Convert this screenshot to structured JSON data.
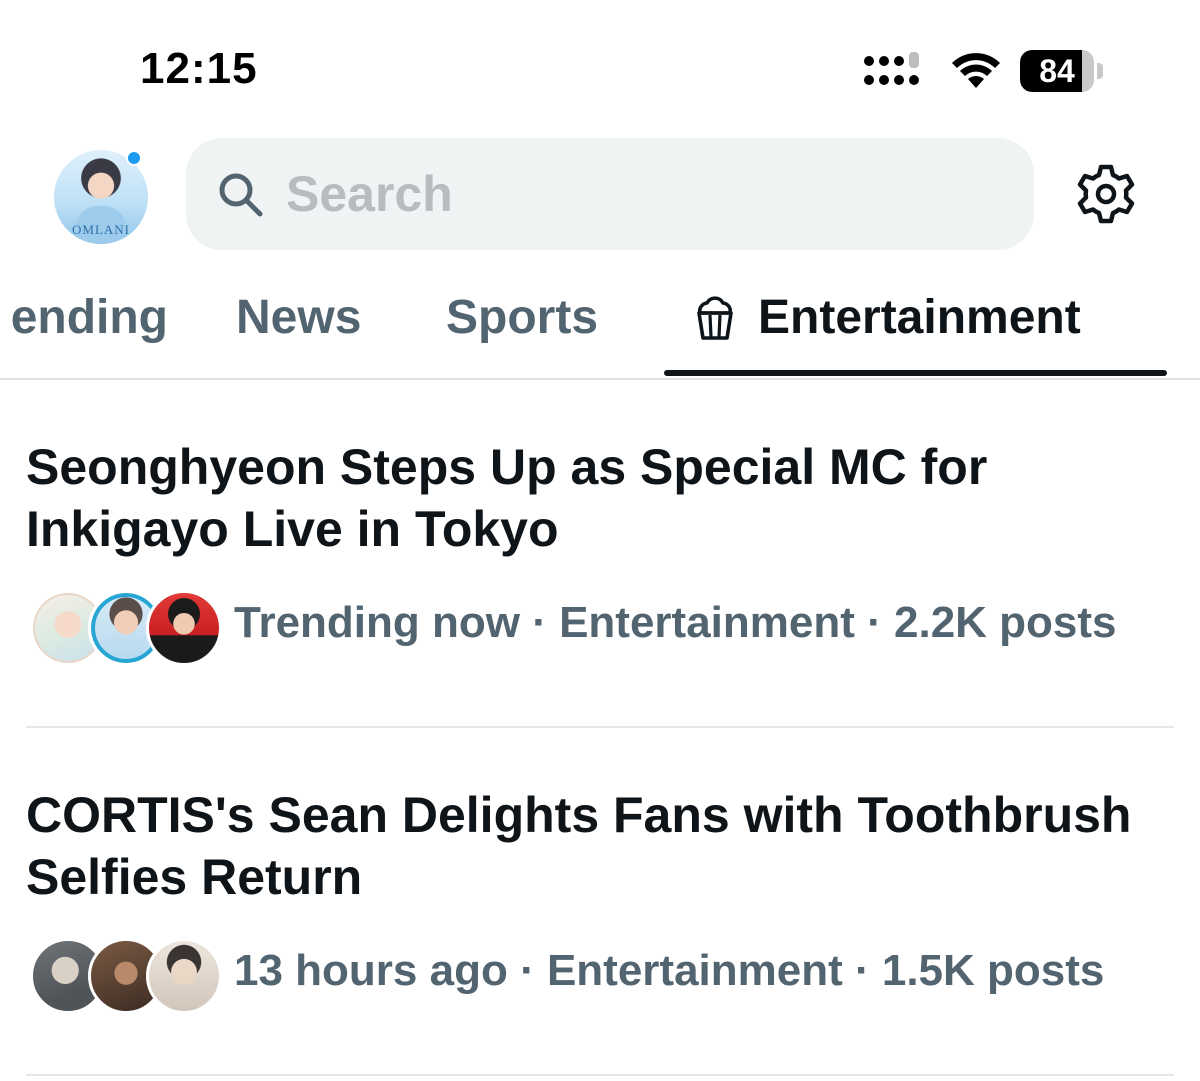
{
  "status_bar": {
    "time": "12:15",
    "battery_percent": 84,
    "battery_label": "84"
  },
  "header": {
    "search": {
      "placeholder": "Search",
      "value": ""
    }
  },
  "tabs": [
    {
      "label": "ending",
      "active": false
    },
    {
      "label": "News",
      "active": false
    },
    {
      "label": "Sports",
      "active": false
    },
    {
      "label": "Entertainment",
      "active": true,
      "icon": "popcorn-icon"
    }
  ],
  "trends": [
    {
      "title": "Seonghyeon Steps Up as Special MC for Inkigayo Live in Tokyo",
      "meta": "Trending now · Entertainment · 2.2K posts"
    },
    {
      "title": "CORTIS's Sean Delights Fans with Toothbrush Selfies Return",
      "meta": "13 hours ago · Entertainment · 1.5K posts"
    }
  ],
  "colors": {
    "accent": "#1d9bf0",
    "text_primary": "#0f1419",
    "text_secondary": "#536471",
    "search_bg": "#eff3f4"
  }
}
